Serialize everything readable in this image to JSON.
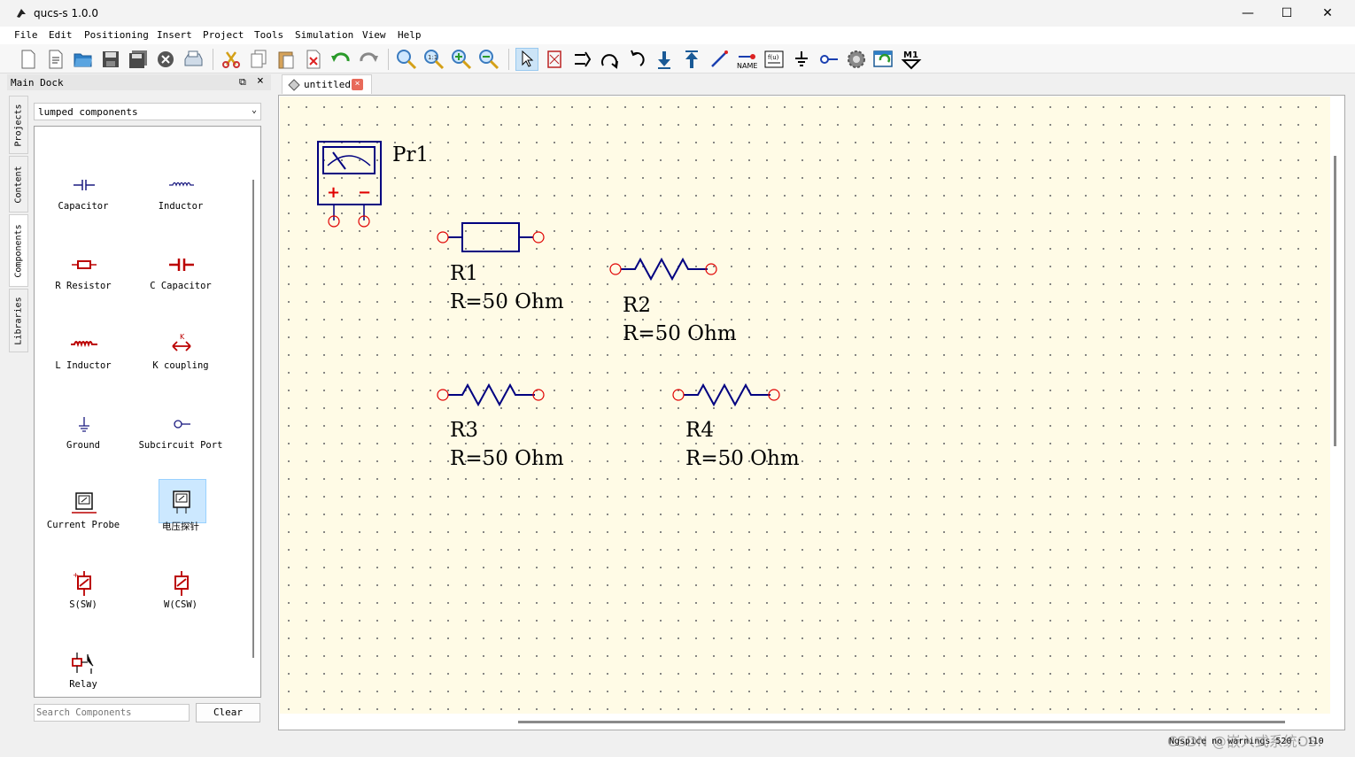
{
  "window": {
    "title": "qucs-s 1.0.0",
    "minimize": "—",
    "maximize": "☐",
    "close": "✕"
  },
  "menu": [
    "File",
    "Edit",
    "Positioning",
    "Insert",
    "Project",
    "Tools",
    "Simulation",
    "View",
    "Help"
  ],
  "toolbar": {
    "icons": [
      "new-icon",
      "new-text-icon",
      "open-icon",
      "save-icon",
      "save-all-icon",
      "close-doc-icon",
      "print-icon",
      "cut-icon",
      "copy-icon",
      "paste-icon",
      "delete-icon",
      "undo-icon",
      "redo-icon",
      "zoom-fit-icon",
      "zoom-11-icon",
      "zoom-in-icon",
      "zoom-out-icon",
      "select-icon",
      "mirror-x-icon",
      "mirror-y-icon",
      "rotate-icon",
      "rotate-ccw-icon",
      "move-down-icon",
      "move-up-icon",
      "wire-icon",
      "wire-label-icon",
      "equation-icon",
      "ground-icon",
      "port-icon",
      "simulate-icon",
      "view-data-icon",
      "marker-icon"
    ],
    "name_text": "NAME",
    "eq_text": "f(u)",
    "marker_text": "M1"
  },
  "dock": {
    "title": "Main Dock",
    "tabs": [
      "Projects",
      "Content",
      "Components",
      "Libraries"
    ],
    "selected_tab": "Components",
    "category": "lumped components",
    "components": [
      {
        "label": "Capacitor",
        "icon": "capacitor-icon"
      },
      {
        "label": "Inductor",
        "icon": "inductor-icon"
      },
      {
        "label": "R Resistor",
        "icon": "r-resistor-icon"
      },
      {
        "label": "C Capacitor",
        "icon": "c-capacitor-icon"
      },
      {
        "label": "L Inductor",
        "icon": "l-inductor-icon"
      },
      {
        "label": "K coupling",
        "icon": "k-coupling-icon"
      },
      {
        "label": "Ground",
        "icon": "ground-icon"
      },
      {
        "label": "Subcircuit Port",
        "icon": "subcircuit-port-icon"
      },
      {
        "label": "Current Probe",
        "icon": "current-probe-icon"
      },
      {
        "label": "电压探针",
        "icon": "voltage-probe-icon"
      },
      {
        "label": "S(SW)",
        "icon": "switch-icon"
      },
      {
        "label": "W(CSW)",
        "icon": "current-switch-icon"
      },
      {
        "label": "Relay",
        "icon": "relay-icon"
      }
    ],
    "search_placeholder": "Search Components",
    "clear_label": "Clear"
  },
  "document": {
    "tab_label": "untitled"
  },
  "schematic": {
    "probe": {
      "name": "Pr1",
      "plus": "+",
      "minus": "−"
    },
    "resistors": [
      {
        "name": "R1",
        "value": "R=50 Ohm"
      },
      {
        "name": "R2",
        "value": "R=50 Ohm"
      },
      {
        "name": "R3",
        "value": "R=50 Ohm"
      },
      {
        "name": "R4",
        "value": "R=50 Ohm"
      }
    ]
  },
  "status": {
    "text": "Ngspice  no warnings   520 : 110"
  },
  "watermark": "CSDN @嵌入式系统OS.",
  "colors": {
    "canvas": "#fffbe6",
    "wire": "#000080",
    "pin": "#ff0000",
    "accent": "#cce4f7"
  }
}
